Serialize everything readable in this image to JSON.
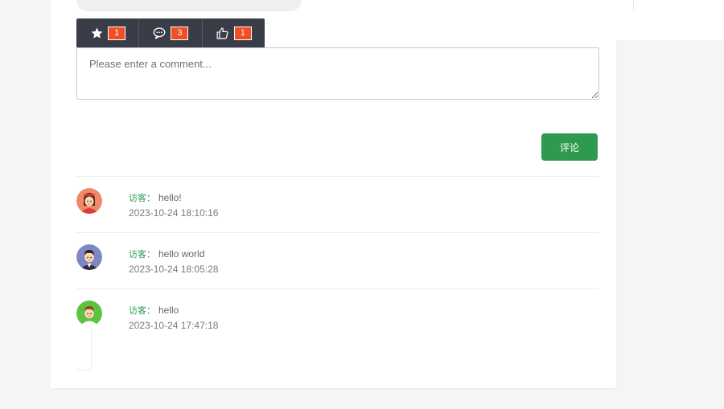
{
  "actions": [
    {
      "name": "favorite",
      "icon": "star-icon",
      "count": "1"
    },
    {
      "name": "comments",
      "icon": "chat-bubble-icon",
      "count": "3"
    },
    {
      "name": "likes",
      "icon": "thumbs-up-icon",
      "count": "1"
    }
  ],
  "comment_form": {
    "placeholder": "Please enter a comment...",
    "value": "",
    "submit_label": "评论"
  },
  "comments": [
    {
      "author": "访客：",
      "message": "hello!",
      "timestamp": "2023-10-24 18:10:16",
      "avatar": "avatar-girl-red-icon"
    },
    {
      "author": "访客：",
      "message": "hello world",
      "timestamp": "2023-10-24 18:05:28",
      "avatar": "avatar-boy-purple-icon"
    },
    {
      "author": "访客：",
      "message": "hello",
      "timestamp": "2023-10-24 17:47:18",
      "avatar": "avatar-boy-green-icon"
    }
  ],
  "colors": {
    "accent": "#2f9a4f",
    "bar": "#383d47",
    "badge": "#ee4f23"
  }
}
